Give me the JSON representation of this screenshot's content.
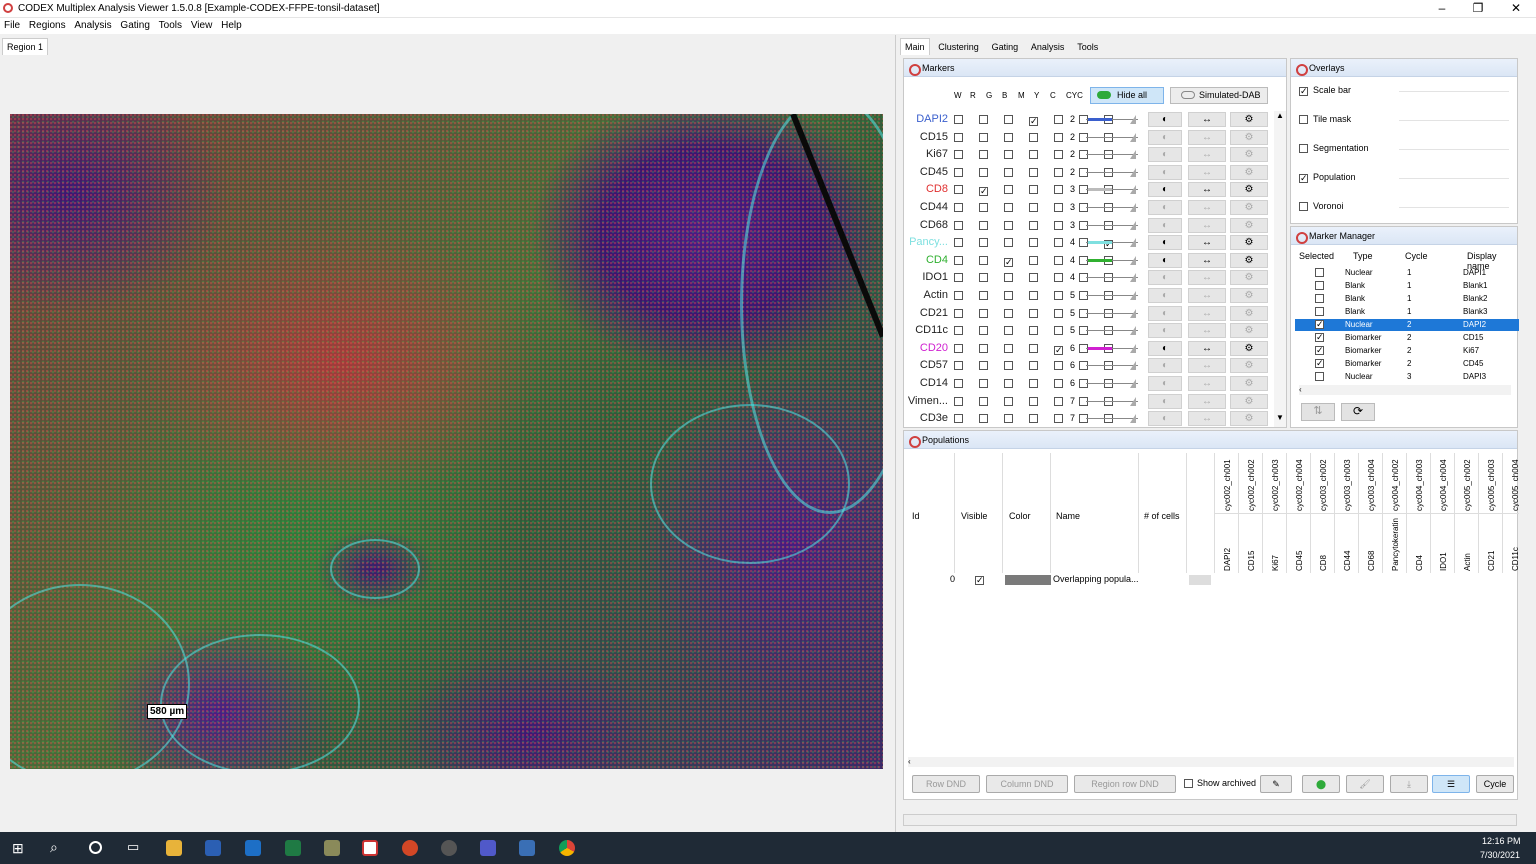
{
  "window": {
    "title": "CODEX Multiplex Analysis Viewer 1.5.0.8 [Example-CODEX-FFPE-tonsil-dataset]",
    "minimize": "–",
    "maximize": "❐",
    "close": "✕"
  },
  "menu": [
    "File",
    "Regions",
    "Analysis",
    "Gating",
    "Tools",
    "View",
    "Help"
  ],
  "left_tab": "Region 1",
  "scale_bar": "580 µm",
  "right_tabs": [
    "Main",
    "Clustering",
    "Gating",
    "Analysis",
    "Tools"
  ],
  "markers_panel": {
    "title": "Markers",
    "col_headers": [
      "W",
      "R",
      "G",
      "B",
      "M",
      "Y",
      "C",
      "CYC"
    ],
    "hide_all": "Hide all",
    "simulated_dab": "Simulated-DAB",
    "rows": [
      {
        "name": "DAPI2",
        "color": "#3a5fcd",
        "cyc": "2",
        "checked": 3,
        "active": true
      },
      {
        "name": "CD15",
        "color": "#222",
        "cyc": "2",
        "checked": -1,
        "active": false
      },
      {
        "name": "Ki67",
        "color": "#222",
        "cyc": "2",
        "checked": -1,
        "active": false
      },
      {
        "name": "CD45",
        "color": "#222",
        "cyc": "2",
        "checked": -1,
        "active": false
      },
      {
        "name": "CD8",
        "color": "#e03030",
        "cyc": "3",
        "checked": 1,
        "active": true
      },
      {
        "name": "CD44",
        "color": "#222",
        "cyc": "3",
        "checked": -1,
        "active": false
      },
      {
        "name": "CD68",
        "color": "#222",
        "cyc": "3",
        "checked": -1,
        "active": false
      },
      {
        "name": "Pancy...",
        "color": "#7fe0e0",
        "cyc": "4",
        "checked": 6,
        "active": true
      },
      {
        "name": "CD4",
        "color": "#30b030",
        "cyc": "4",
        "checked": 2,
        "active": true
      },
      {
        "name": "IDO1",
        "color": "#222",
        "cyc": "4",
        "checked": -1,
        "active": false
      },
      {
        "name": "Actin",
        "color": "#222",
        "cyc": "5",
        "checked": -1,
        "active": false
      },
      {
        "name": "CD21",
        "color": "#222",
        "cyc": "5",
        "checked": -1,
        "active": false
      },
      {
        "name": "CD11c",
        "color": "#222",
        "cyc": "5",
        "checked": -1,
        "active": false
      },
      {
        "name": "CD20",
        "color": "#d020d0",
        "cyc": "6",
        "checked": 4,
        "active": true
      },
      {
        "name": "CD57",
        "color": "#222",
        "cyc": "6",
        "checked": -1,
        "active": false
      },
      {
        "name": "CD14",
        "color": "#222",
        "cyc": "6",
        "checked": -1,
        "active": false
      },
      {
        "name": "Vimen...",
        "color": "#222",
        "cyc": "7",
        "checked": -1,
        "active": false
      },
      {
        "name": "CD3e",
        "color": "#222",
        "cyc": "7",
        "checked": -1,
        "active": false
      }
    ],
    "slider_colors": {
      "DAPI2": "#3a5fcd",
      "CD8": "#bbb",
      "Pancy...": "#7fe0e0",
      "CD4": "#30b030",
      "CD20": "#d020d0"
    }
  },
  "overlays": {
    "title": "Overlays",
    "items": [
      {
        "label": "Scale bar",
        "checked": true
      },
      {
        "label": "Tile mask",
        "checked": false
      },
      {
        "label": "Segmentation",
        "checked": false
      },
      {
        "label": "Population",
        "checked": true
      },
      {
        "label": "Voronoi",
        "checked": false
      }
    ]
  },
  "marker_manager": {
    "title": "Marker Manager",
    "headers": [
      "Selected",
      "Type",
      "Cycle",
      "Display name"
    ],
    "rows": [
      {
        "sel": false,
        "type": "Nuclear",
        "cycle": "1",
        "name": "DAPI1",
        "hl": false
      },
      {
        "sel": false,
        "type": "Blank",
        "cycle": "1",
        "name": "Blank1",
        "hl": false
      },
      {
        "sel": false,
        "type": "Blank",
        "cycle": "1",
        "name": "Blank2",
        "hl": false
      },
      {
        "sel": false,
        "type": "Blank",
        "cycle": "1",
        "name": "Blank3",
        "hl": false
      },
      {
        "sel": true,
        "type": "Nuclear",
        "cycle": "2",
        "name": "DAPI2",
        "hl": true
      },
      {
        "sel": true,
        "type": "Biomarker",
        "cycle": "2",
        "name": "CD15",
        "hl": false
      },
      {
        "sel": true,
        "type": "Biomarker",
        "cycle": "2",
        "name": "Ki67",
        "hl": false
      },
      {
        "sel": true,
        "type": "Biomarker",
        "cycle": "2",
        "name": "CD45",
        "hl": false
      },
      {
        "sel": false,
        "type": "Nuclear",
        "cycle": "3",
        "name": "DAPI3",
        "hl": false
      }
    ]
  },
  "populations": {
    "title": "Populations",
    "headers": [
      "Id",
      "Visible",
      "Color",
      "Name",
      "# of cells"
    ],
    "channel_top": [
      "cyc002_ch001",
      "cyc002_ch002",
      "cyc002_ch003",
      "cyc002_ch004",
      "cyc003_ch002",
      "cyc003_ch003",
      "cyc003_ch004",
      "cyc004_ch002",
      "cyc004_ch003",
      "cyc004_ch004",
      "cyc005_ch002",
      "cyc005_ch003",
      "cyc005_ch004"
    ],
    "channel_bottom": [
      "DAPI2",
      "CD15",
      "Ki67",
      "CD45",
      "CD8",
      "CD44",
      "CD68",
      "Pancytokeratin",
      "CD4",
      "IDO1",
      "Actin",
      "CD21",
      "CD11c"
    ],
    "row": {
      "id": "0",
      "name": "Overlapping popula..."
    },
    "buttons": {
      "row_dnd": "Row DND",
      "col_dnd": "Column DND",
      "region_row_dnd": "Region row DND",
      "show_archived": "Show archived",
      "cycle": "Cycle"
    }
  },
  "taskbar": {
    "time": "12:16 PM",
    "date": "7/30/2021"
  }
}
